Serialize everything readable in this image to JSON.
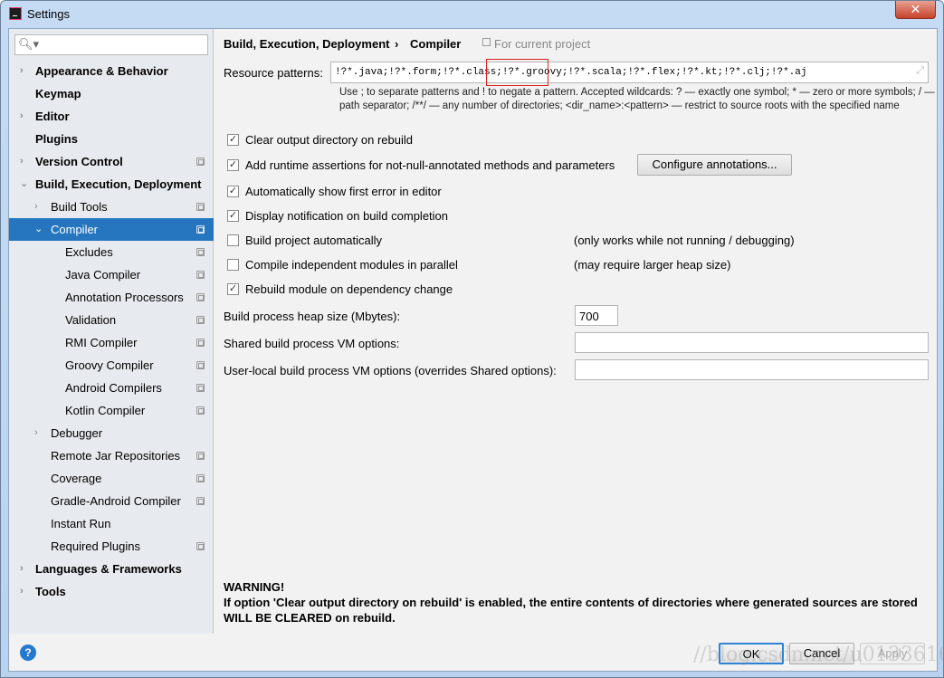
{
  "window": {
    "title": "Settings",
    "close_glyph": "✕"
  },
  "search": {
    "placeholder": ""
  },
  "sidebar": {
    "items": [
      {
        "label": "Appearance & Behavior",
        "bold": true,
        "arrow": "›",
        "level": 0
      },
      {
        "label": "Keymap",
        "bold": true,
        "level": 0
      },
      {
        "label": "Editor",
        "bold": true,
        "arrow": "›",
        "level": 0
      },
      {
        "label": "Plugins",
        "bold": true,
        "level": 0
      },
      {
        "label": "Version Control",
        "bold": true,
        "arrow": "›",
        "level": 0,
        "project": true
      },
      {
        "label": "Build, Execution, Deployment",
        "bold": true,
        "arrow": "⌄",
        "level": 0
      },
      {
        "label": "Build Tools",
        "arrow": "›",
        "level": 1,
        "project": true
      },
      {
        "label": "Compiler",
        "arrow": "⌄",
        "level": 1,
        "project": true,
        "selected": true
      },
      {
        "label": "Excludes",
        "level": 2,
        "project": true
      },
      {
        "label": "Java Compiler",
        "level": 2,
        "project": true
      },
      {
        "label": "Annotation Processors",
        "level": 2,
        "project": true
      },
      {
        "label": "Validation",
        "level": 2,
        "project": true
      },
      {
        "label": "RMI Compiler",
        "level": 2,
        "project": true
      },
      {
        "label": "Groovy Compiler",
        "level": 2,
        "project": true
      },
      {
        "label": "Android Compilers",
        "level": 2,
        "project": true
      },
      {
        "label": "Kotlin Compiler",
        "level": 2,
        "project": true
      },
      {
        "label": "Debugger",
        "arrow": "›",
        "level": 1
      },
      {
        "label": "Remote Jar Repositories",
        "level": 1,
        "project": true
      },
      {
        "label": "Coverage",
        "level": 1,
        "project": true
      },
      {
        "label": "Gradle-Android Compiler",
        "level": 1,
        "project": true
      },
      {
        "label": "Instant Run",
        "level": 1
      },
      {
        "label": "Required Plugins",
        "level": 1,
        "project": true
      },
      {
        "label": "Languages & Frameworks",
        "bold": true,
        "arrow": "›",
        "level": 0
      },
      {
        "label": "Tools",
        "bold": true,
        "arrow": "›",
        "level": 0
      }
    ]
  },
  "main": {
    "breadcrumb": {
      "parent": "Build, Execution, Deployment",
      "sep": "›",
      "current": "Compiler",
      "scope": "For current project"
    },
    "resource_label": "Resource patterns:",
    "resource_value": "!?*.java;!?*.form;!?*.class;!?*.groovy;!?*.scala;!?*.flex;!?*.kt;!?*.clj;!?*.aj",
    "hint": "Use ; to separate patterns and ! to negate a pattern. Accepted wildcards: ? — exactly one symbol; * — zero or more symbols; / — path separator; /**/ — any number of directories; <dir_name>:<pattern> — restrict to source roots with the specified name",
    "options": [
      {
        "label": "Clear output directory on rebuild",
        "checked": true
      },
      {
        "label": "Add runtime assertions for not-null-annotated methods and parameters",
        "checked": true,
        "button": "Configure annotations..."
      },
      {
        "label": "Automatically show first error in editor",
        "checked": true
      },
      {
        "label": "Display notification on build completion",
        "checked": true
      },
      {
        "label": "Build project automatically",
        "checked": false,
        "note": "(only works while not running / debugging)"
      },
      {
        "label": "Compile independent modules in parallel",
        "checked": false,
        "note": "(may require larger heap size)"
      },
      {
        "label": "Rebuild module on dependency change",
        "checked": true
      }
    ],
    "heap_label": "Build process heap size (Mbytes):",
    "heap_value": "700",
    "shared_label": "Shared build process VM options:",
    "shared_value": "",
    "user_label": "User-local build process VM options (overrides Shared options):",
    "user_value": "",
    "warning_title": "WARNING!",
    "warning_line1": "If option 'Clear output directory on rebuild' is enabled, the entire contents of directories where generated sources are stored",
    "warning_line2": "WILL BE CLEARED on rebuild."
  },
  "footer": {
    "help": "?",
    "ok": "OK",
    "cancel": "Cancel",
    "apply": "Apply"
  },
  "watermark": "//blog.csdn.net/u013361668",
  "colors": {
    "selection": "#2675bf",
    "highlight_box": "#e02020"
  }
}
